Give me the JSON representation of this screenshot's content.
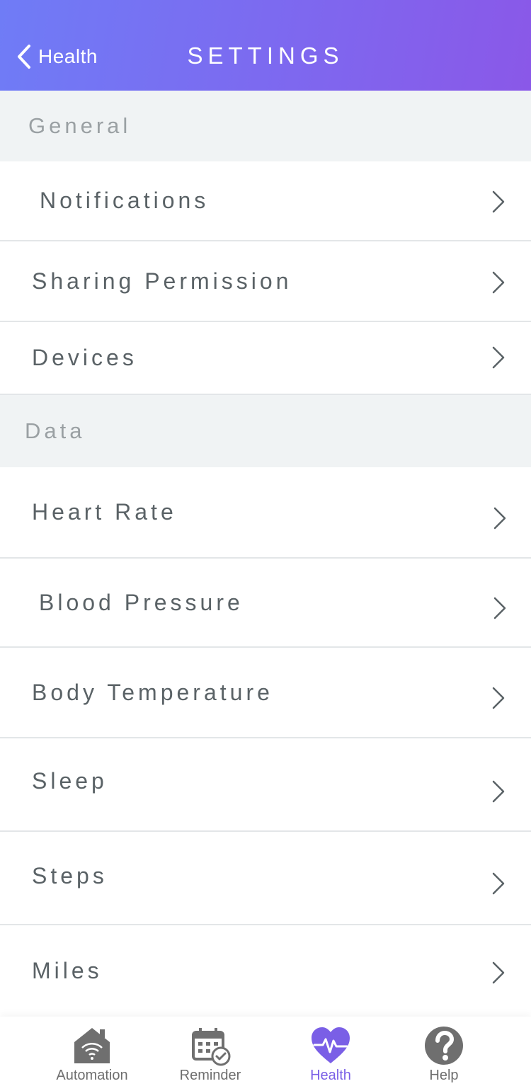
{
  "header": {
    "back_label": "Health",
    "title": "SETTINGS"
  },
  "sections": {
    "general": {
      "title": "General",
      "items": [
        "Notifications",
        "Sharing Permission",
        "Devices"
      ]
    },
    "data": {
      "title": "Data",
      "items": [
        "Heart Rate",
        "Blood Pressure",
        "Body Temperature",
        "Sleep",
        "Steps",
        "Miles"
      ]
    }
  },
  "tabbar": {
    "active": "Health",
    "tabs": [
      {
        "label": "Automation",
        "icon": "home-wifi-icon"
      },
      {
        "label": "Reminder",
        "icon": "calendar-check-icon"
      },
      {
        "label": "Health",
        "icon": "heart-pulse-icon"
      },
      {
        "label": "Help",
        "icon": "help-circle-icon"
      }
    ]
  },
  "colors": {
    "header_gradient_start": "#6f7cf6",
    "header_gradient_end": "#8a58e8",
    "section_bg": "#f0f3f4",
    "active_tab": "#7a5fe6"
  }
}
